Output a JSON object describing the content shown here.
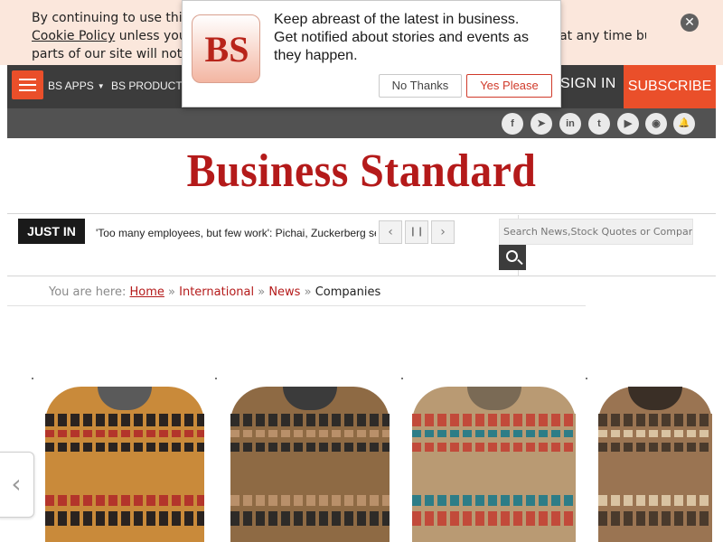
{
  "cookie": {
    "line1": "By continuing to use this site you consent to the use of cookies as described in our",
    "link": "Cookie Policy",
    "line2_rest": " unless you have disabled them. You can change your cookie settings at any time but",
    "line3": "parts of our site will not function correctly without them.",
    "close_icon": "close-icon"
  },
  "nav": {
    "menu_icon": "hamburger-icon",
    "apps_label": "BS APPS",
    "products_label": "BS PRODUCTS",
    "signin_label": "SIGN IN",
    "subscribe_label": "SUBSCRIBE",
    "accent": "#ea4f2a"
  },
  "social": [
    {
      "name": "facebook-icon",
      "glyph": "f"
    },
    {
      "name": "telegram-icon",
      "glyph": "➤"
    },
    {
      "name": "linkedin-icon",
      "glyph": "in"
    },
    {
      "name": "twitter-icon",
      "glyph": "t"
    },
    {
      "name": "youtube-icon",
      "glyph": "▶"
    },
    {
      "name": "rss-icon",
      "glyph": "◉"
    },
    {
      "name": "notification-bell-icon",
      "glyph": "🔔"
    }
  ],
  "logo": {
    "text": "Business Standard",
    "color": "#b41a1a"
  },
  "justin": {
    "label": "JUST IN",
    "headline": "'Too many employees, but few work': Pichai, Zuckerberg set bar high for staff",
    "prev_icon": "‹",
    "pause_icon": "❙❙",
    "next_icon": "›"
  },
  "search": {
    "placeholder": "Search News,Stock Quotes or Companies"
  },
  "breadcrumb": {
    "prefix": "You are here: ",
    "items": [
      "Home",
      "International",
      "News"
    ],
    "separator": " » ",
    "current": "Companies"
  },
  "popup": {
    "logo_text": "BS",
    "message": "Keep abreast of the latest in business. Get notified about stories and events as they happen.",
    "no_label": "No Thanks",
    "yes_label": "Yes Please"
  },
  "ad": {
    "left_arrow": "‹",
    "items": [
      {
        "name": "ad-shirt-antelope",
        "base": "#c98a3a",
        "band": "#2a2320",
        "accent": "#b3352b",
        "collar": "#5a5a5a"
      },
      {
        "name": "ad-shirt-aztec",
        "base": "#8e6a44",
        "band": "#2e2b28",
        "accent": "#b9906a",
        "collar": "#3b3b3b"
      },
      {
        "name": "ad-shirt-geometric",
        "base": "#b99a73",
        "band": "#c24a3a",
        "accent": "#2d7d87",
        "collar": "#7a6a55"
      },
      {
        "name": "ad-shirt-buffalo",
        "base": "#9a7452",
        "band": "#4a3a2c",
        "accent": "#d9c3a2",
        "collar": "#3a2f26"
      }
    ]
  }
}
